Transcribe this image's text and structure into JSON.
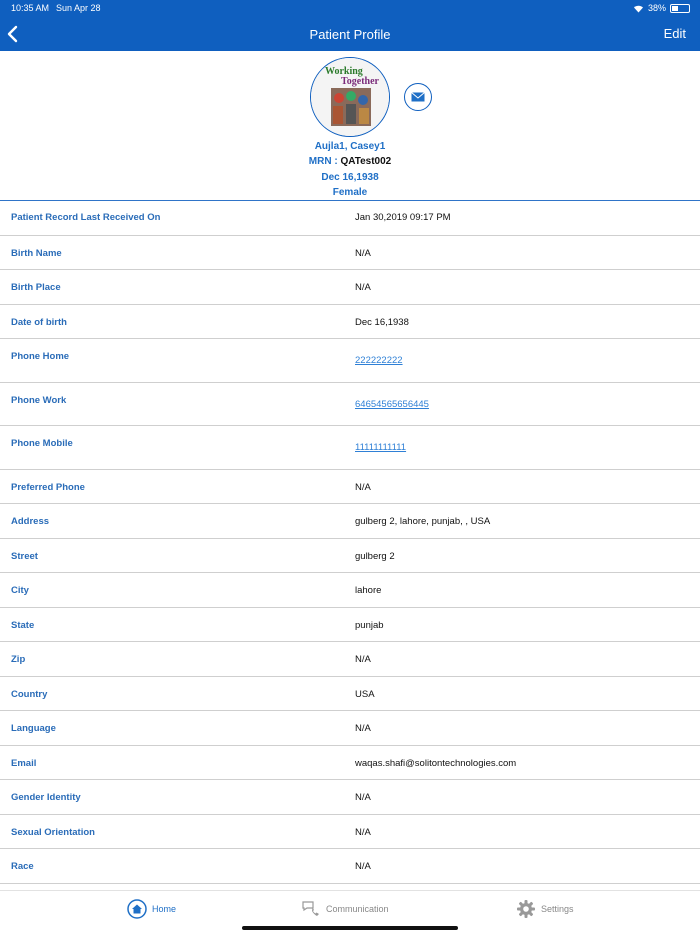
{
  "status_bar": {
    "time": "10:35 AM",
    "date": "Sun Apr 28",
    "battery": "38%"
  },
  "nav": {
    "title": "Patient Profile",
    "edit_label": "Edit"
  },
  "profile": {
    "name": "Aujla1, Casey1",
    "mrn_label": "MRN :",
    "mrn_value": "QATest002",
    "dob": "Dec 16,1938",
    "gender": "Female",
    "avatar_text": [
      "Working",
      "Together"
    ]
  },
  "fields": [
    {
      "label": "Patient Record Last Received On",
      "value": "Jan 30,2019 09:17 PM"
    },
    {
      "label": "Birth Name",
      "value": "N/A"
    },
    {
      "label": "Birth Place",
      "value": "N/A"
    },
    {
      "label": "Date of birth",
      "value": "Dec 16,1938"
    },
    {
      "label": "Phone Home",
      "value": "222222222"
    },
    {
      "label": "Phone Work",
      "value": "64654565656445"
    },
    {
      "label": "Phone Mobile",
      "value": "11111111111"
    },
    {
      "label": "Preferred Phone",
      "value": "N/A"
    },
    {
      "label": "Address",
      "value": "gulberg 2, lahore, punjab, , USA"
    },
    {
      "label": "Street",
      "value": "gulberg 2"
    },
    {
      "label": "City",
      "value": "lahore"
    },
    {
      "label": "State",
      "value": "punjab"
    },
    {
      "label": "Zip",
      "value": "N/A"
    },
    {
      "label": "Country",
      "value": "USA"
    },
    {
      "label": "Language",
      "value": "N/A"
    },
    {
      "label": "Email",
      "value": "waqas.shafi@solitontechnologies.com"
    },
    {
      "label": "Gender Identity",
      "value": "N/A"
    },
    {
      "label": "Sexual Orientation",
      "value": "N/A"
    },
    {
      "label": "Race",
      "value": "N/A"
    }
  ],
  "tabs": {
    "home": "Home",
    "communication": "Communication",
    "settings": "Settings"
  },
  "colors": {
    "brand": "#0f5fbf",
    "label": "#2a6cb8",
    "link": "#2f80d6"
  },
  "icons": {
    "back": "chevron-left-icon",
    "mail": "envelope-icon",
    "home": "home-icon",
    "communication": "chat-phone-icon",
    "settings": "gear-icon"
  }
}
